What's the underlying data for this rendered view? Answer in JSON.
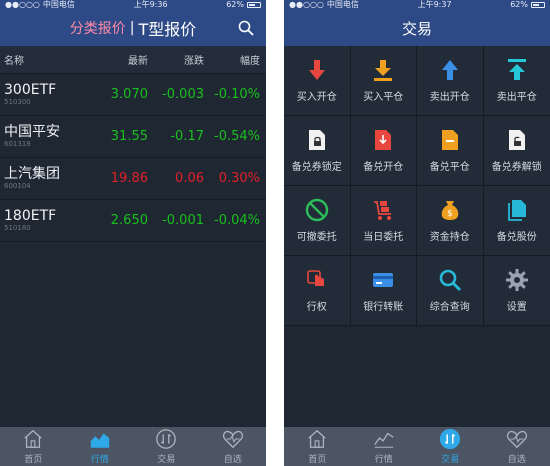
{
  "left": {
    "status": {
      "carrier": "中国电信",
      "time": "上午9:36",
      "battery": "62%"
    },
    "nav": {
      "tab_active": "分类报价",
      "separator": "|",
      "tab_other": "T型报价"
    },
    "table": {
      "headers": [
        "名称",
        "最新",
        "涨跌",
        "幅度"
      ],
      "rows": [
        {
          "name": "300ETF",
          "code": "510300",
          "last": "3.070",
          "change": "-0.003",
          "pct": "-0.10%",
          "color": "green"
        },
        {
          "name": "中国平安",
          "code": "601318",
          "last": "31.55",
          "change": "-0.17",
          "pct": "-0.54%",
          "color": "green"
        },
        {
          "name": "上汽集团",
          "code": "600104",
          "last": "19.86",
          "change": "0.06",
          "pct": "0.30%",
          "color": "red"
        },
        {
          "name": "180ETF",
          "code": "510180",
          "last": "2.650",
          "change": "-0.001",
          "pct": "-0.04%",
          "color": "green"
        }
      ]
    },
    "tabbar": [
      "首页",
      "行情",
      "交易",
      "自选"
    ],
    "tabbar_active": "行情"
  },
  "right": {
    "status": {
      "carrier": "中国电信",
      "time": "上午9:37",
      "battery": "62%"
    },
    "nav": {
      "title": "交易"
    },
    "grid": [
      {
        "label": "买入开仓",
        "icon": "arrow-down-red-icon"
      },
      {
        "label": "买入平仓",
        "icon": "arrow-down-bar-orange-icon"
      },
      {
        "label": "卖出开仓",
        "icon": "arrow-up-blue-icon"
      },
      {
        "label": "卖出平仓",
        "icon": "arrow-up-bar-cyan-icon"
      },
      {
        "label": "备兑券锁定",
        "icon": "doc-lock-icon"
      },
      {
        "label": "备兑开仓",
        "icon": "doc-red-icon"
      },
      {
        "label": "备兑平仓",
        "icon": "doc-orange-icon"
      },
      {
        "label": "备兑券解锁",
        "icon": "doc-unlock-icon"
      },
      {
        "label": "可撤委托",
        "icon": "cancel-circle-icon"
      },
      {
        "label": "当日委托",
        "icon": "cart-icon"
      },
      {
        "label": "资金持仓",
        "icon": "money-bag-icon"
      },
      {
        "label": "备兑股份",
        "icon": "doc-stack-icon"
      },
      {
        "label": "行权",
        "icon": "hand-pointer-icon"
      },
      {
        "label": "银行转账",
        "icon": "bank-card-icon"
      },
      {
        "label": "综合查询",
        "icon": "search-magnifier-icon"
      },
      {
        "label": "设置",
        "icon": "gear-icon"
      }
    ],
    "tabbar": [
      "首页",
      "行情",
      "交易",
      "自选"
    ],
    "tabbar_active": "交易"
  },
  "colors": {
    "nav_blue": "#2d4a86",
    "green": "#18c01c",
    "red": "#e2202a",
    "active_tab": "#2fa9e8",
    "accent_pink": "#ff8aa8"
  }
}
